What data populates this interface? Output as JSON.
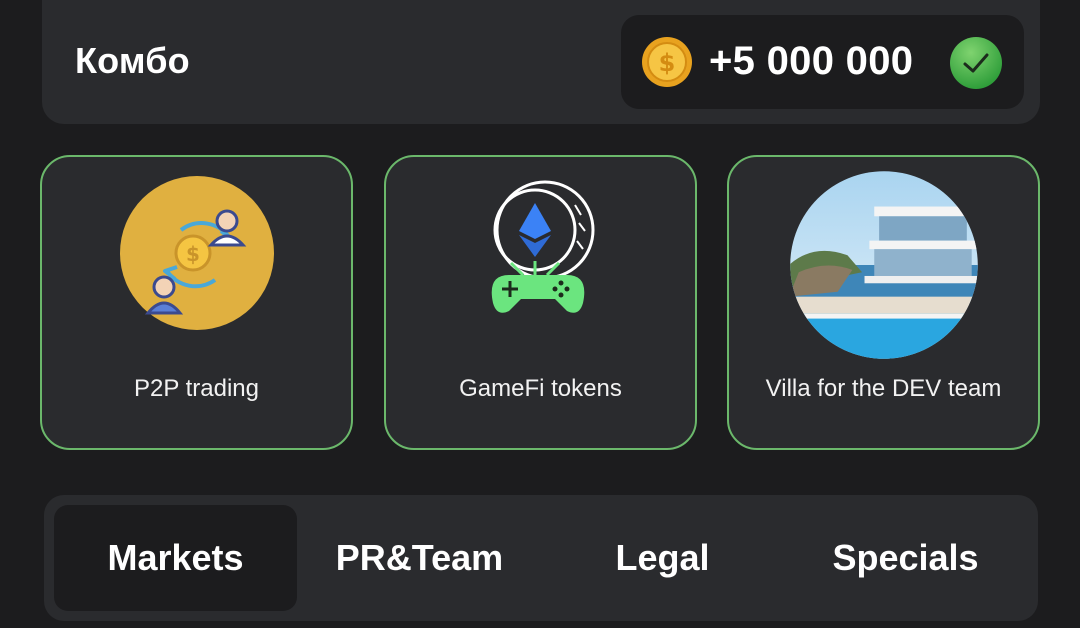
{
  "combo": {
    "title": "Комбо",
    "reward": "+5 000 000"
  },
  "cards": [
    {
      "label": "P2P trading",
      "icon": "p2p-trading-icon"
    },
    {
      "label": "GameFi tokens",
      "icon": "gamefi-controller-icon"
    },
    {
      "label": "Villa for the DEV team",
      "icon": "villa-image"
    }
  ],
  "tabs": [
    {
      "label": "Markets",
      "active": true
    },
    {
      "label": "PR&Team",
      "active": false
    },
    {
      "label": "Legal",
      "active": false
    },
    {
      "label": "Specials",
      "active": false
    }
  ],
  "colors": {
    "background": "#1c1c1e",
    "panel": "#2a2b2e",
    "card_border": "#6bb86b",
    "coin": "#f0b429",
    "check": "#4caf50",
    "controller": "#6be57f",
    "eth": "#3b82f6"
  }
}
